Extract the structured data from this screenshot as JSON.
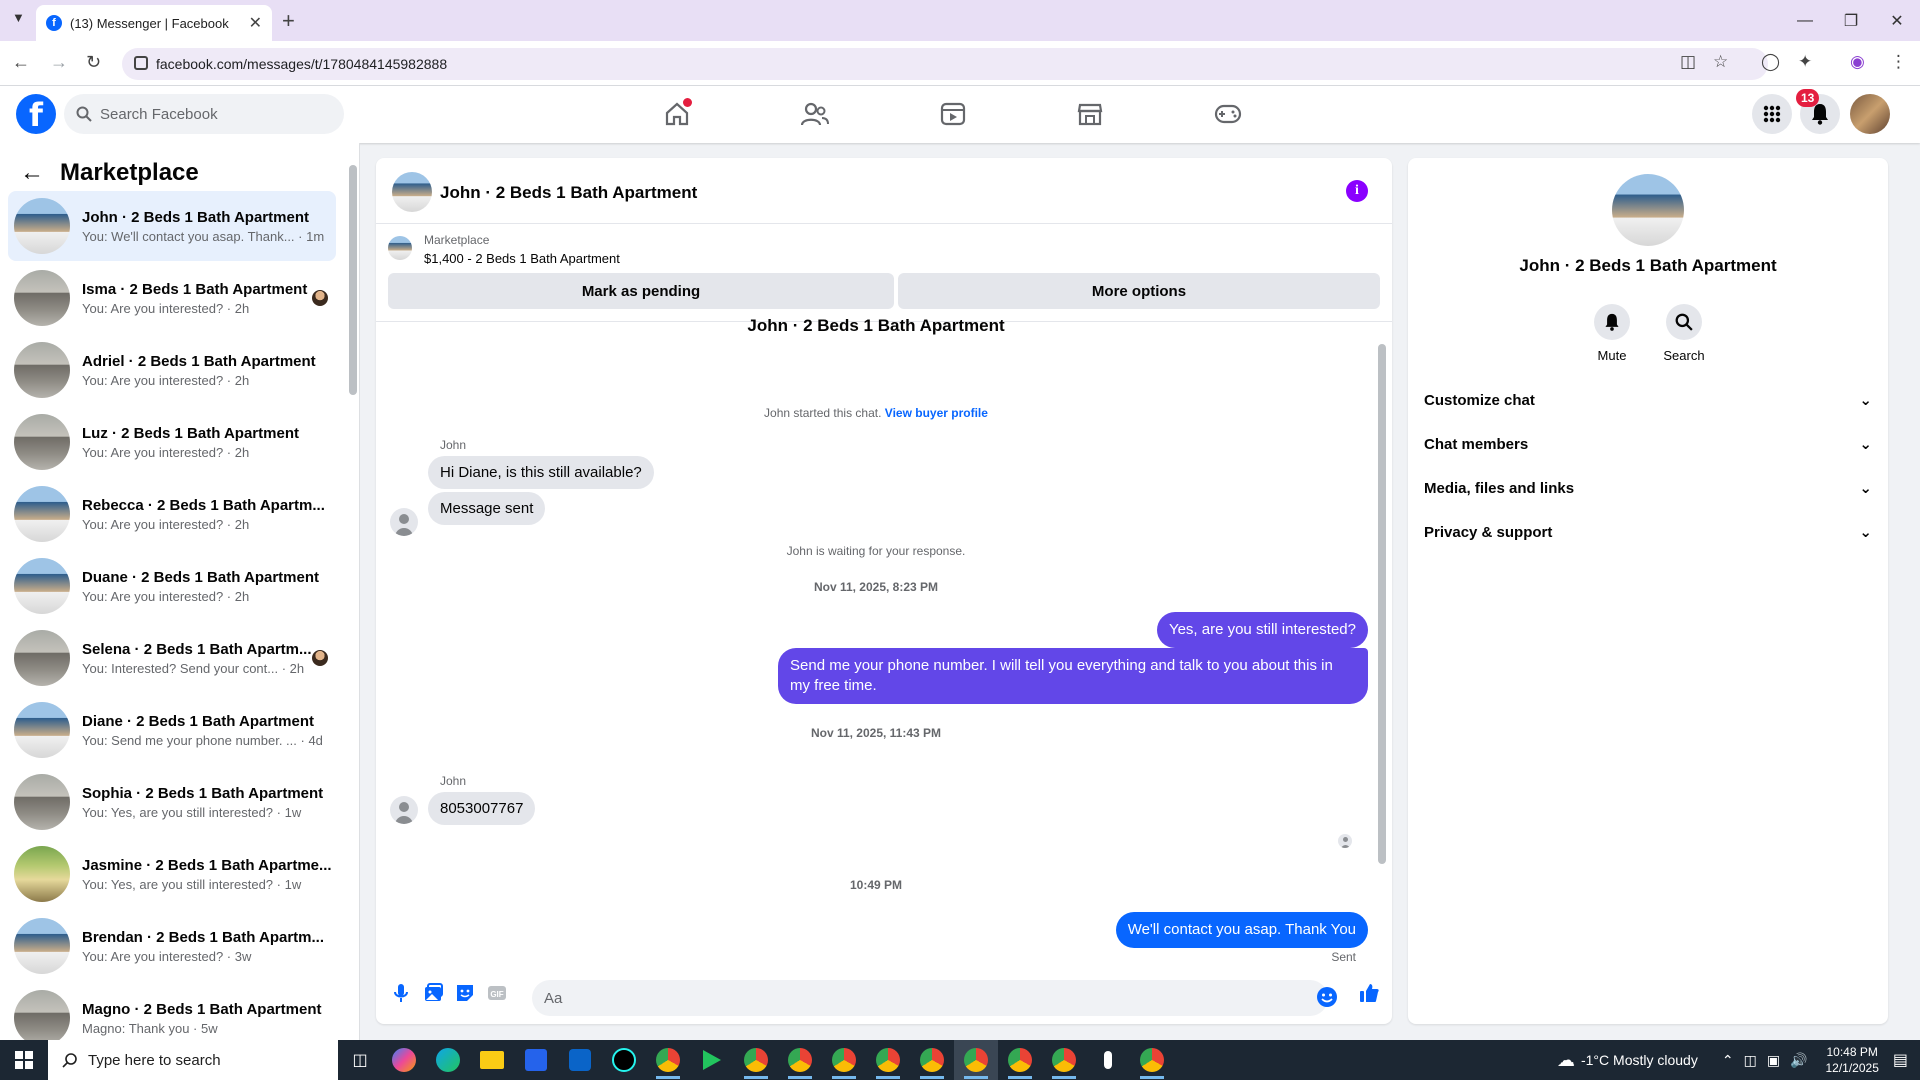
{
  "browser": {
    "tab_title": "(13) Messenger | Facebook",
    "url": "facebook.com/messages/t/1780484145982888",
    "new_tab_label": "+"
  },
  "fb": {
    "search_placeholder": "Search Facebook",
    "notification_count": "13",
    "nav_icons": [
      "home-icon",
      "friends-icon",
      "video-icon",
      "marketplace-icon",
      "gaming-icon"
    ]
  },
  "sidebar": {
    "title": "Marketplace",
    "conversations": [
      {
        "name": "John · 2 Beds 1 Bath Apartment",
        "preview": "You: We'll contact you asap. Thank... · 1m",
        "thumb": "house"
      },
      {
        "name": "Isma · 2 Beds 1 Bath Apartment",
        "preview": "You: Are you interested? · 2h",
        "thumb": "room"
      },
      {
        "name": "Adriel · 2 Beds 1 Bath Apartment",
        "preview": "You: Are you interested? · 2h",
        "thumb": "room"
      },
      {
        "name": "Luz · 2 Beds 1 Bath Apartment",
        "preview": "You: Are you interested? · 2h",
        "thumb": "room"
      },
      {
        "name": "Rebecca · 2 Beds 1 Bath Apartm...",
        "preview": "You: Are you interested? · 2h",
        "thumb": "house"
      },
      {
        "name": "Duane · 2 Beds 1 Bath Apartment",
        "preview": "You: Are you interested? · 2h",
        "thumb": "house"
      },
      {
        "name": "Selena · 2 Beds 1 Bath Apartm...",
        "preview": "You: Interested? Send your cont... · 2h",
        "thumb": "room"
      },
      {
        "name": "Diane · 2 Beds 1 Bath Apartment",
        "preview": "You: Send me your phone number. ... · 4d",
        "thumb": "house"
      },
      {
        "name": "Sophia · 2 Beds 1 Bath Apartment",
        "preview": "You: Yes, are you still interested? · 1w",
        "thumb": "room"
      },
      {
        "name": "Jasmine · 2 Beds 1 Bath Apartme...",
        "preview": "You: Yes, are you still interested? · 1w",
        "thumb": "green"
      },
      {
        "name": "Brendan · 2 Beds 1 Bath Apartm...",
        "preview": "You: Are you interested? · 3w",
        "thumb": "house"
      },
      {
        "name": "Magno · 2 Beds 1 Bath Apartment",
        "preview": "Magno: Thank you · 5w",
        "thumb": "room"
      }
    ]
  },
  "chat": {
    "title": "John · 2 Beds 1 Bath Apartment",
    "listing_source": "Marketplace",
    "listing_price": "$1,400 - 2 Beds 1 Bath Apartment",
    "mark_pending_label": "Mark as pending",
    "more_options_label": "More options",
    "thread_title": "John · 2 Beds 1 Bath Apartment",
    "started_text": "John started this chat.",
    "view_profile_link": "View buyer profile",
    "sender_name_1": "John",
    "msg_in_1": "Hi Diane, is this still available?",
    "msg_in_2": "Message sent",
    "waiting_text": "John is waiting for your response.",
    "timestamp_1": "Nov 11, 2025, 8:23 PM",
    "msg_out_1": "Yes, are you still interested?",
    "msg_out_2": "Send me your phone number. I will tell you everything and talk to you about this in my free time.",
    "timestamp_2": "Nov 11, 2025, 11:43 PM",
    "sender_name_2": "John",
    "msg_in_3": "8053007767",
    "timestamp_3": "10:49 PM",
    "msg_out_3": "We'll contact you asap. Thank You",
    "sent_status": "Sent",
    "composer_placeholder": "Aa"
  },
  "info": {
    "name": "John · 2 Beds 1 Bath Apartment",
    "mute_label": "Mute",
    "search_label": "Search",
    "sections": [
      "Customize chat",
      "Chat members",
      "Media, files and links",
      "Privacy & support"
    ]
  },
  "taskbar": {
    "search_placeholder": "Type here to search",
    "weather": "-1°C  Mostly cloudy",
    "time": "10:48 PM",
    "date": "12/1/2025"
  },
  "colors": {
    "fb_blue": "#0866ff",
    "outgoing_bubble": "#6247e8",
    "incoming_bubble": "#e4e6eb",
    "notification_red": "#e41e3f"
  }
}
